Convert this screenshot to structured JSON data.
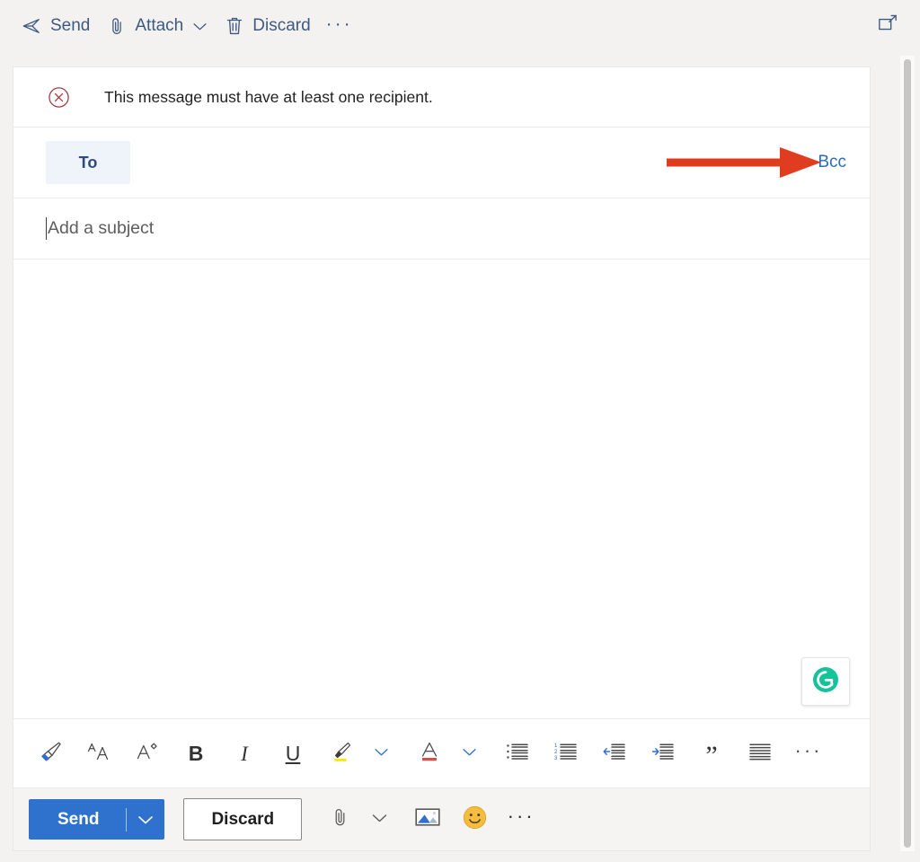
{
  "top_bar": {
    "send_label": "Send",
    "attach_label": "Attach",
    "discard_label": "Discard",
    "more_label": "···",
    "popout_icon": "pop-out-icon"
  },
  "banner": {
    "icon": "error-circle-x-icon",
    "message": "This message must have at least one recipient.",
    "icon_color": "#a4373a"
  },
  "recipients": {
    "to_label": "To",
    "to_chip_bg": "#eff4fb",
    "to_chip_color": "#2b4a7e",
    "bcc_label": "Bcc",
    "bcc_color": "#2b6cb8",
    "annotation_arrow_color": "#e03c1f"
  },
  "subject": {
    "placeholder": "Add a subject",
    "value": ""
  },
  "body": {
    "value": "",
    "grammarly_label": "G",
    "grammarly_color": "#15c39a"
  },
  "format_toolbar": {
    "items": [
      {
        "name": "format-painter-icon",
        "label": "Format painter"
      },
      {
        "name": "font-family-icon",
        "label": "Font"
      },
      {
        "name": "font-size-icon",
        "label": "Font size"
      },
      {
        "name": "bold-icon",
        "label": "B"
      },
      {
        "name": "italic-icon",
        "label": "I"
      },
      {
        "name": "underline-icon",
        "label": "U"
      },
      {
        "name": "highlight-icon",
        "label": "Highlight"
      },
      {
        "name": "highlight-dropdown-icon",
        "label": "Highlight options"
      },
      {
        "name": "font-color-icon",
        "label": "Font color"
      },
      {
        "name": "font-color-dropdown-icon",
        "label": "Font color options"
      },
      {
        "name": "bulleted-list-icon",
        "label": "Bulleted list"
      },
      {
        "name": "numbered-list-icon",
        "label": "Numbered list"
      },
      {
        "name": "decrease-indent-icon",
        "label": "Decrease indent"
      },
      {
        "name": "increase-indent-icon",
        "label": "Increase indent"
      },
      {
        "name": "quote-icon",
        "label": "”"
      },
      {
        "name": "align-icon",
        "label": "Align"
      },
      {
        "name": "more-formatting-icon",
        "label": "···"
      }
    ]
  },
  "action_bar": {
    "send_label": "Send",
    "send_bg": "#2f72cd",
    "send_dropdown_icon": "chevron-down-icon",
    "discard_label": "Discard",
    "attach_icon": "paperclip-icon",
    "attach_dropdown_icon": "chevron-down-icon",
    "image_icon": "insert-picture-icon",
    "emoji_icon": "smiley-face-icon",
    "more_icon": "···"
  }
}
